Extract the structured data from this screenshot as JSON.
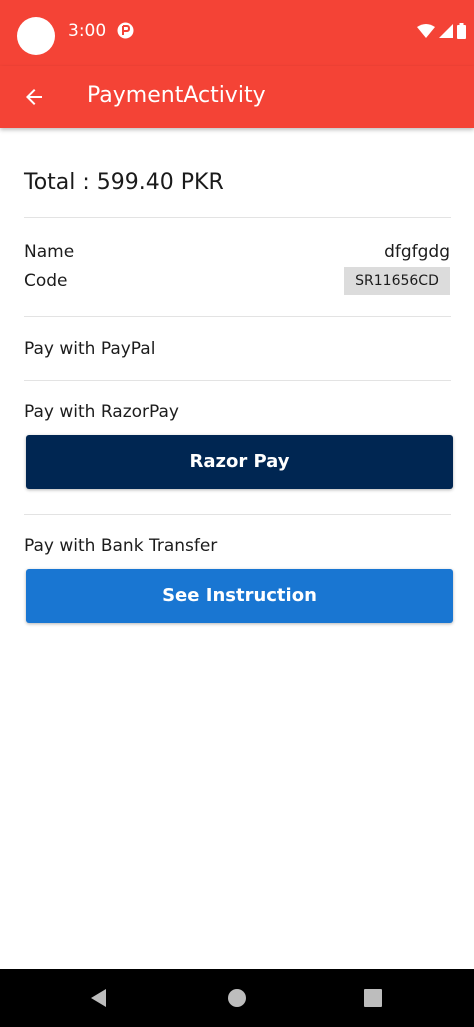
{
  "status_bar": {
    "time": "3:00",
    "background_color": "#f44336",
    "icons": [
      "avatar",
      "app-notification-icon",
      "wifi-icon",
      "signal-icon",
      "battery-icon"
    ]
  },
  "app_bar": {
    "title": "PaymentActivity",
    "back_icon": "arrow-back-icon"
  },
  "summary": {
    "total": "Total : 599.40 PKR",
    "name_label": "Name",
    "name_value": "dfgfgdg",
    "code_label": "Code",
    "code_value": "SR11656CD"
  },
  "paypal": {
    "title": "Pay with PayPal"
  },
  "razorpay": {
    "title": "Pay with RazorPay",
    "button_label": "Razor Pay",
    "button_color": "#002652"
  },
  "bank_transfer": {
    "title": "Pay with Bank Transfer",
    "button_label": "See Instruction",
    "button_color": "#1976d2"
  },
  "nav_bar": {
    "icons": [
      "back-triangle-icon",
      "home-circle-icon",
      "recents-square-icon"
    ]
  }
}
